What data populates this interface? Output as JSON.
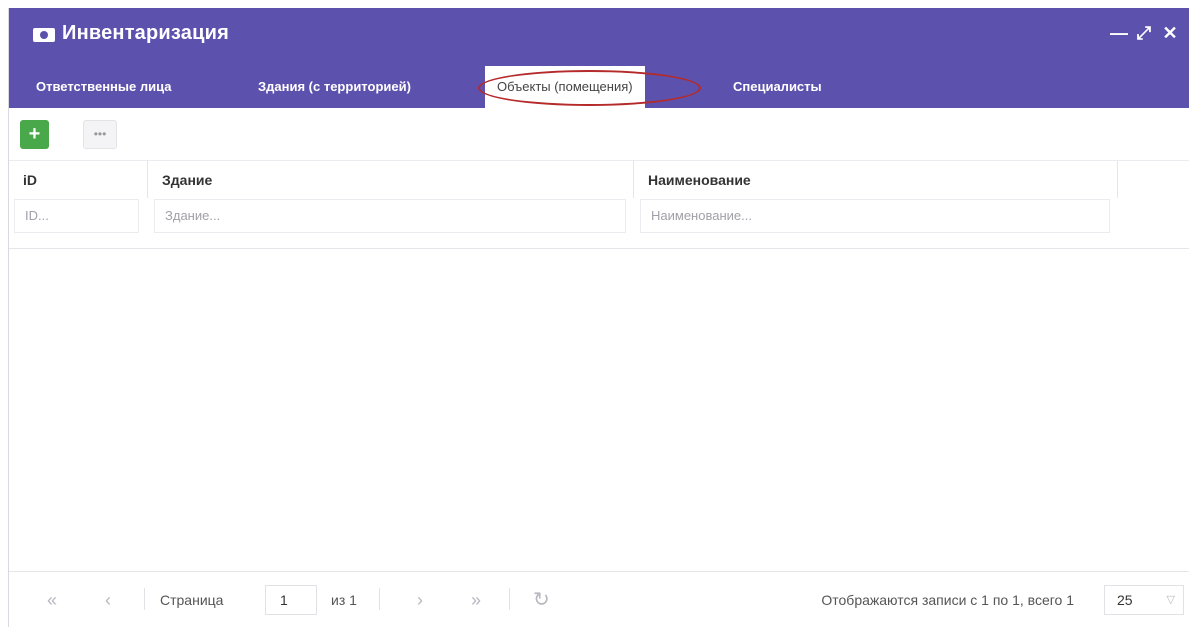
{
  "window": {
    "title": "Инвентаризация",
    "controls": {
      "minimize": "—",
      "maximize": "⤢",
      "close": "✕"
    }
  },
  "tabs": [
    {
      "label": "Ответственные лица",
      "active": false
    },
    {
      "label": "Здания (с территорией)",
      "active": false
    },
    {
      "label": "Объекты (помещения)",
      "active": true
    },
    {
      "label": "Специалисты",
      "active": false
    }
  ],
  "toolbar": {
    "add_label": "+",
    "more_label": "•••"
  },
  "grid": {
    "columns": [
      {
        "header": "iD",
        "filter_placeholder": "ID..."
      },
      {
        "header": "Здание",
        "filter_placeholder": "Здание..."
      },
      {
        "header": "Наименование",
        "filter_placeholder": "Наименование..."
      }
    ],
    "rows": []
  },
  "pager": {
    "first": "«",
    "prev": "‹",
    "page_label": "Страница",
    "page_value": "1",
    "of_label": "из 1",
    "next": "›",
    "last": "»",
    "refresh": "↻",
    "info": "Отображаются записи с 1 по 1, всего 1",
    "page_size": "25",
    "page_size_caret": "▽"
  },
  "colors": {
    "header_bg": "#5c52ad",
    "add_button": "#48a84a",
    "highlight_ellipse": "#b52a2a"
  }
}
